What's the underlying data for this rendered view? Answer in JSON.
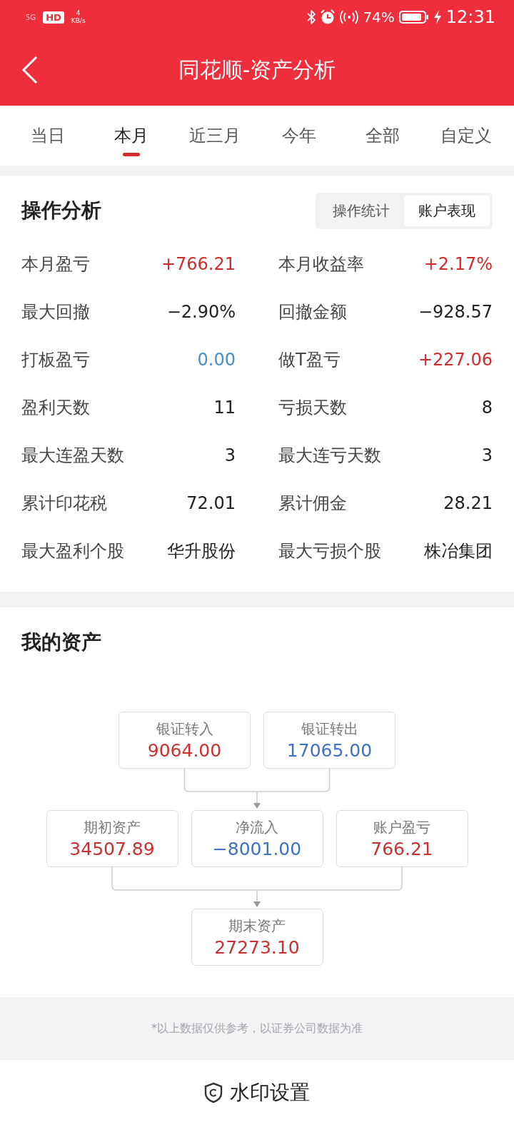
{
  "status_bar": {
    "network": "5G",
    "hd": "HD",
    "speed_value": "4",
    "speed_unit": "KB/s",
    "battery": "74%",
    "time": "12:31"
  },
  "header": {
    "title": "同花顺-资产分析"
  },
  "tabs": [
    {
      "label": "当日",
      "selected": false
    },
    {
      "label": "本月",
      "selected": true
    },
    {
      "label": "近三月",
      "selected": false
    },
    {
      "label": "今年",
      "selected": false
    },
    {
      "label": "全部",
      "selected": false
    },
    {
      "label": "自定义",
      "selected": false
    }
  ],
  "analysis": {
    "title": "操作分析",
    "toggle": [
      {
        "label": "操作统计",
        "selected": false
      },
      {
        "label": "账户表现",
        "selected": true
      }
    ],
    "rows": [
      [
        {
          "label": "本月盈亏",
          "value": "+766.21",
          "color": "#d22b2b"
        },
        {
          "label": "本月收益率",
          "value": "+2.17%",
          "color": "#d22b2b"
        }
      ],
      [
        {
          "label": "最大回撤",
          "value": "−2.90%",
          "color": "#222222"
        },
        {
          "label": "回撤金额",
          "value": "−928.57",
          "color": "#222222"
        }
      ],
      [
        {
          "label": "打板盈亏",
          "value": "0.00",
          "color": "#4a8fc4"
        },
        {
          "label": "做T盈亏",
          "value": "+227.06",
          "color": "#d22b2b"
        }
      ],
      [
        {
          "label": "盈利天数",
          "value": "11",
          "color": "#222222"
        },
        {
          "label": "亏损天数",
          "value": "8",
          "color": "#222222"
        }
      ],
      [
        {
          "label": "最大连盈天数",
          "value": "3",
          "color": "#222222"
        },
        {
          "label": "最大连亏天数",
          "value": "3",
          "color": "#222222"
        }
      ],
      [
        {
          "label": "累计印花税",
          "value": "72.01",
          "color": "#222222"
        },
        {
          "label": "累计佣金",
          "value": "28.21",
          "color": "#222222"
        }
      ],
      [
        {
          "label": "最大盈利个股",
          "value": "华升股份",
          "color": "#222222"
        },
        {
          "label": "最大亏损个股",
          "value": "株冶集团",
          "color": "#222222"
        }
      ]
    ]
  },
  "assets": {
    "title": "我的资产",
    "flow": [
      [
        {
          "label": "银证转入",
          "value": "9064.00",
          "color": "#c8312f"
        },
        {
          "label": "银证转出",
          "value": "17065.00",
          "color": "#3e72c4"
        }
      ],
      [
        {
          "label": "期初资产",
          "value": "34507.89",
          "color": "#c8312f"
        },
        {
          "label": "净流入",
          "value": "−8001.00",
          "color": "#3e72c4"
        },
        {
          "label": "账户盈亏",
          "value": "766.21",
          "color": "#c8312f"
        }
      ],
      [
        {
          "label": "期末资产",
          "value": "27273.10",
          "color": "#c8312f"
        }
      ]
    ]
  },
  "disclaimer": "*以上数据仅供参考，以证券公司数据为准",
  "footer": {
    "label": "水印设置"
  }
}
